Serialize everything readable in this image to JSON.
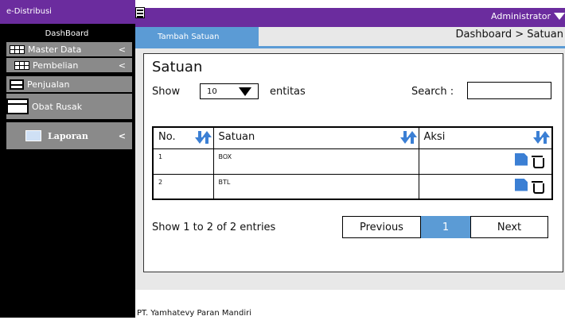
{
  "sidebar": {
    "brand": "e-Distribusi",
    "items": [
      {
        "label": "DashBoard"
      },
      {
        "label": "Master Data",
        "arrow": "<"
      },
      {
        "label": "Pembelian",
        "arrow": "<"
      },
      {
        "label": "Penjualan"
      },
      {
        "label": "Obat Rusak"
      },
      {
        "label": "Laporan",
        "arrow": "<"
      }
    ]
  },
  "topbar": {
    "user": "Administrator"
  },
  "content": {
    "tab_label": "Tambah Satuan",
    "breadcrumb": "Dashboard > Satuan"
  },
  "panel": {
    "title": "Satuan",
    "show_label": "Show",
    "page_size": "10",
    "entities_label": "entitas",
    "search_label": "Search :",
    "search_value": ""
  },
  "table": {
    "headers": [
      "No.",
      "Satuan",
      "Aksi"
    ],
    "rows": [
      {
        "no": "1",
        "satuan": "BOX"
      },
      {
        "no": "2",
        "satuan": "BTL"
      }
    ]
  },
  "pagination": {
    "summary": "Show 1 to 2 of 2 entries",
    "previous": "Previous",
    "current": "1",
    "next": "Next"
  },
  "footer": {
    "company": "PT. Yamhatevy Paran Mandiri"
  },
  "colors": {
    "brand_purple": "#6b2c9e",
    "accent_blue": "#5b9bd5"
  },
  "icons": [
    "menu-icon",
    "grid-icon",
    "table-icon",
    "box-icon",
    "folder-icon",
    "sort-icon",
    "edit-icon",
    "trash-icon",
    "caret-down-icon"
  ]
}
